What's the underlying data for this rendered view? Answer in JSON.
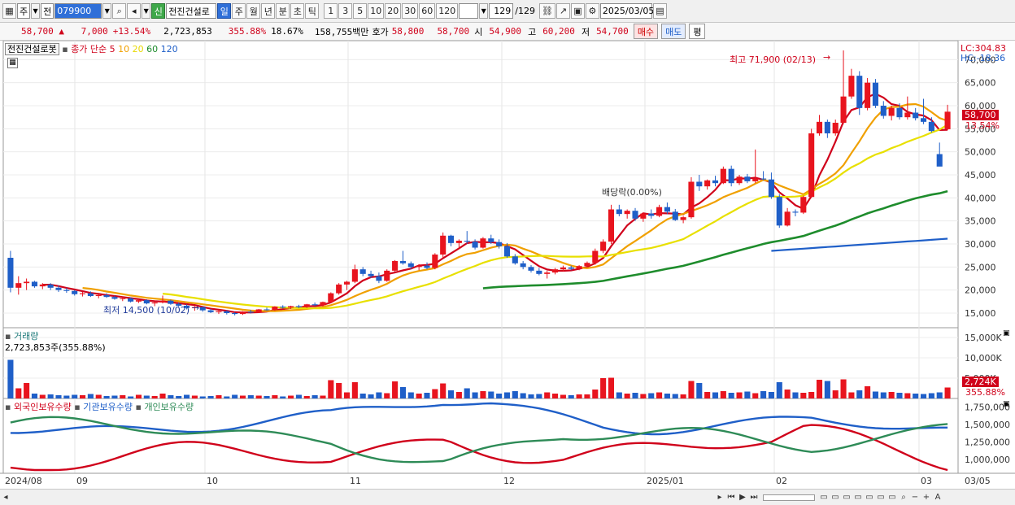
{
  "toolbar": {
    "period": "주",
    "prev": "전",
    "code": "079900",
    "new_badge": "신",
    "name": "전진건설로",
    "periods": [
      "일",
      "주",
      "월",
      "년",
      "분",
      "초",
      "틱"
    ],
    "active_period": "일",
    "intervals": [
      "1",
      "3",
      "5",
      "10",
      "20",
      "30",
      "60",
      "120"
    ],
    "count": "129",
    "total": "/129",
    "date": "2025/03/05"
  },
  "quote": {
    "price": "58,700",
    "change": "7,000",
    "change_pct": "+13.54%",
    "volume": "2,723,853",
    "vol_ratio": "355.88%",
    "turnover": "18.67%",
    "amount": "158,755백만",
    "bid_label": "호가",
    "bid": "58,800",
    "ask": "58,700",
    "open_label": "시",
    "open": "54,900",
    "high_label": "고",
    "high": "60,200",
    "low_label": "저",
    "low": "54,700",
    "buy": "매수",
    "sell": "매도",
    "eval": "평"
  },
  "price_panel": {
    "name_label": "전진건설로봇",
    "ma_label": "종가 단순",
    "ma_periods": [
      "5",
      "10",
      "20",
      "60",
      "120"
    ],
    "ma_colors": [
      "#d0021b",
      "#f0a000",
      "#e8e000",
      "#1e8c2c",
      "#1f5fc8"
    ],
    "lc": "LC:304.83",
    "hc": "HC:-18.36",
    "high_note": "최고 71,900 (02/13)",
    "low_note": "최저 14,500 (10/02)",
    "dividend_note": "배당락(0.00%)",
    "last_price_tag": "58,700",
    "last_pct_tag": "13.54%",
    "y_ticks": [
      "70,000",
      "65,000",
      "60,000",
      "55,000",
      "50,000",
      "45,000",
      "40,000",
      "35,000",
      "30,000",
      "25,000",
      "20,000",
      "15,000"
    ]
  },
  "volume_panel": {
    "label": "거래량",
    "value": "2,723,853주(355.88%)",
    "y_ticks": [
      "15,000K",
      "10,000K",
      "5,000K"
    ],
    "last_tag": "2,724K",
    "last_pct": "355.88%"
  },
  "holding_panel": {
    "labels": [
      "외국인보유수량",
      "기관보유수량",
      "개인보유수량"
    ],
    "colors": [
      "#d0021b",
      "#1f5fc8",
      "#2e8b57"
    ],
    "y_ticks": [
      "1,750,000",
      "1,500,000",
      "1,250,000",
      "1,000,000"
    ]
  },
  "x_axis": {
    "labels": [
      "2024/08",
      "09",
      "10",
      "11",
      "12",
      "2025/01",
      "02",
      "03"
    ],
    "right_label": "03/05"
  },
  "chart_data": {
    "type": "candlestick",
    "y_range": [
      12000,
      72000
    ],
    "candles": [
      [
        27000,
        28500,
        19500,
        20500
      ],
      [
        20500,
        23000,
        19000,
        21500
      ],
      [
        21500,
        22500,
        20000,
        21800
      ],
      [
        21800,
        22000,
        20500,
        20800
      ],
      [
        20800,
        21500,
        20200,
        21200
      ],
      [
        21200,
        21500,
        20000,
        20500
      ],
      [
        20500,
        21000,
        19600,
        20000
      ],
      [
        20000,
        20500,
        19400,
        19800
      ],
      [
        19800,
        20000,
        18800,
        19100
      ],
      [
        19100,
        19600,
        18600,
        19300
      ],
      [
        19300,
        19700,
        18500,
        18700
      ],
      [
        18700,
        19100,
        18200,
        18900
      ],
      [
        18900,
        19300,
        18300,
        18500
      ],
      [
        18500,
        18800,
        17900,
        18100
      ],
      [
        18100,
        18500,
        17600,
        18200
      ],
      [
        18200,
        18400,
        17300,
        17500
      ],
      [
        17500,
        18000,
        17200,
        17800
      ],
      [
        17800,
        18000,
        16900,
        17100
      ],
      [
        17100,
        17500,
        16500,
        17300
      ],
      [
        17300,
        18800,
        17100,
        17700
      ],
      [
        17700,
        17900,
        16800,
        17000
      ],
      [
        17000,
        17300,
        16400,
        16600
      ],
      [
        16600,
        16900,
        15800,
        16100
      ],
      [
        16100,
        16500,
        15500,
        16300
      ],
      [
        16300,
        16400,
        15300,
        15600
      ],
      [
        15600,
        15900,
        15000,
        15200
      ],
      [
        15200,
        15500,
        14800,
        15400
      ],
      [
        15400,
        15600,
        14700,
        15000
      ],
      [
        15000,
        15200,
        14500,
        14800
      ],
      [
        14800,
        15400,
        14600,
        15300
      ],
      [
        15300,
        15700,
        14900,
        15100
      ],
      [
        15100,
        15900,
        15000,
        15800
      ],
      [
        15800,
        16200,
        15500,
        15700
      ],
      [
        15700,
        16500,
        15500,
        16400
      ],
      [
        16400,
        16700,
        16000,
        16200
      ],
      [
        16200,
        16600,
        15900,
        16500
      ],
      [
        16500,
        16800,
        16100,
        16300
      ],
      [
        16300,
        17000,
        16100,
        16900
      ],
      [
        16900,
        17300,
        16500,
        16700
      ],
      [
        16700,
        17500,
        16400,
        17400
      ],
      [
        17400,
        19500,
        17200,
        19300
      ],
      [
        19300,
        21500,
        19000,
        21200
      ],
      [
        21200,
        22000,
        20000,
        21800
      ],
      [
        21800,
        25500,
        21500,
        24500
      ],
      [
        24500,
        25000,
        23000,
        23500
      ],
      [
        23500,
        24200,
        22600,
        23000
      ],
      [
        23000,
        23800,
        21500,
        22000
      ],
      [
        22000,
        24500,
        21800,
        24200
      ],
      [
        24200,
        26500,
        24000,
        26300
      ],
      [
        26300,
        28500,
        25500,
        25800
      ],
      [
        25800,
        26200,
        24500,
        25000
      ],
      [
        25000,
        25600,
        24300,
        25300
      ],
      [
        25300,
        26000,
        24500,
        24800
      ],
      [
        24800,
        28000,
        24500,
        27700
      ],
      [
        27700,
        32500,
        27000,
        31800
      ],
      [
        31800,
        32000,
        29500,
        30200
      ],
      [
        30200,
        31000,
        29000,
        30700
      ],
      [
        30700,
        32800,
        30000,
        30500
      ],
      [
        30500,
        31000,
        28800,
        29200
      ],
      [
        29200,
        31500,
        29000,
        31200
      ],
      [
        31200,
        32000,
        30000,
        30400
      ],
      [
        30400,
        31000,
        29000,
        29500
      ],
      [
        29500,
        30200,
        27000,
        27300
      ],
      [
        27300,
        27800,
        25500,
        25800
      ],
      [
        25800,
        26300,
        24500,
        25000
      ],
      [
        25000,
        25400,
        23800,
        24200
      ],
      [
        24200,
        24800,
        23200,
        23500
      ],
      [
        23500,
        24200,
        22500,
        23800
      ],
      [
        23800,
        24800,
        23400,
        24500
      ],
      [
        24500,
        25300,
        24000,
        24900
      ],
      [
        24900,
        25300,
        24300,
        24600
      ],
      [
        24600,
        25400,
        24300,
        25200
      ],
      [
        25200,
        26200,
        24900,
        25900
      ],
      [
        25900,
        29000,
        25500,
        28500
      ],
      [
        28500,
        31000,
        28000,
        30500
      ],
      [
        30500,
        38500,
        30000,
        37500
      ],
      [
        37500,
        38500,
        36000,
        36500
      ],
      [
        36500,
        37500,
        35500,
        37200
      ],
      [
        37200,
        37800,
        35000,
        35500
      ],
      [
        35500,
        36800,
        34800,
        36600
      ],
      [
        36600,
        37500,
        35500,
        36100
      ],
      [
        36100,
        38500,
        35800,
        38000
      ],
      [
        38000,
        39000,
        36500,
        37000
      ],
      [
        37000,
        37600,
        35000,
        35200
      ],
      [
        35200,
        36000,
        34500,
        35800
      ],
      [
        35800,
        44500,
        35500,
        43500
      ],
      [
        43500,
        45000,
        41500,
        42500
      ],
      [
        42500,
        44000,
        41800,
        43800
      ],
      [
        43800,
        44800,
        42500,
        43200
      ],
      [
        43200,
        46800,
        43000,
        46300
      ],
      [
        46300,
        47000,
        42500,
        43200
      ],
      [
        43200,
        45000,
        42800,
        44600
      ],
      [
        44600,
        45200,
        43200,
        43600
      ],
      [
        43600,
        50500,
        43200,
        44200
      ],
      [
        44200,
        45800,
        43800,
        44000
      ],
      [
        44000,
        45500,
        39800,
        40200
      ],
      [
        40200,
        40800,
        33500,
        34000
      ],
      [
        34000,
        37800,
        33800,
        37000
      ],
      [
        37000,
        37500,
        36000,
        36800
      ],
      [
        36800,
        40500,
        36500,
        40200
      ],
      [
        40200,
        55000,
        40000,
        54000
      ],
      [
        54000,
        58000,
        53500,
        56500
      ],
      [
        56500,
        57000,
        53000,
        54000
      ],
      [
        54000,
        57000,
        53500,
        56300
      ],
      [
        56300,
        72000,
        56000,
        62000
      ],
      [
        62000,
        68000,
        61500,
        66500
      ],
      [
        66500,
        67500,
        58000,
        59500
      ],
      [
        59500,
        66000,
        59000,
        65000
      ],
      [
        65000,
        65800,
        59500,
        60000
      ],
      [
        60000,
        61000,
        57200,
        57800
      ],
      [
        57800,
        60000,
        56800,
        59500
      ],
      [
        59500,
        60500,
        57000,
        57500
      ],
      [
        57500,
        62000,
        57000,
        58500
      ],
      [
        58500,
        59500,
        56800,
        57300
      ],
      [
        57300,
        61500,
        56000,
        56500
      ],
      [
        56500,
        57500,
        54200,
        54500
      ],
      [
        49500,
        52000,
        47000,
        46800
      ],
      [
        54900,
        60200,
        54700,
        58700
      ]
    ],
    "volume": [
      9.5,
      2.5,
      3.8,
      1.2,
      0.9,
      1.0,
      0.8,
      0.7,
      0.9,
      0.8,
      1.1,
      0.9,
      0.6,
      0.7,
      0.8,
      0.5,
      0.9,
      0.7,
      0.6,
      1.2,
      0.8,
      0.6,
      0.9,
      0.7,
      0.5,
      0.6,
      0.8,
      0.5,
      0.9,
      0.7,
      0.8,
      0.7,
      0.6,
      0.8,
      0.5,
      0.7,
      0.9,
      0.6,
      0.8,
      0.7,
      4.5,
      3.8,
      1.5,
      4.0,
      1.2,
      1.0,
      1.5,
      1.3,
      4.2,
      2.8,
      1.5,
      1.2,
      1.4,
      2.3,
      3.7,
      2.0,
      1.6,
      2.5,
      1.5,
      1.8,
      1.7,
      1.2,
      1.5,
      1.8,
      1.3,
      1.0,
      1.1,
      1.5,
      1.2,
      0.9,
      0.8,
      1.0,
      1.0,
      2.2,
      5.0,
      5.1,
      1.5,
      1.2,
      1.4,
      1.1,
      1.3,
      1.5,
      1.2,
      1.1,
      1.0,
      4.3,
      3.8,
      1.6,
      1.5,
      1.8,
      1.4,
      1.5,
      1.7,
      1.3,
      1.8,
      1.6,
      4.0,
      2.2,
      1.5,
      1.4,
      1.6,
      4.6,
      4.3,
      2.0,
      4.7,
      1.5,
      2.0,
      3.0,
      1.7,
      1.5,
      1.6,
      1.4,
      1.3,
      1.2,
      1.1,
      1.3,
      1.5,
      2.7
    ]
  }
}
